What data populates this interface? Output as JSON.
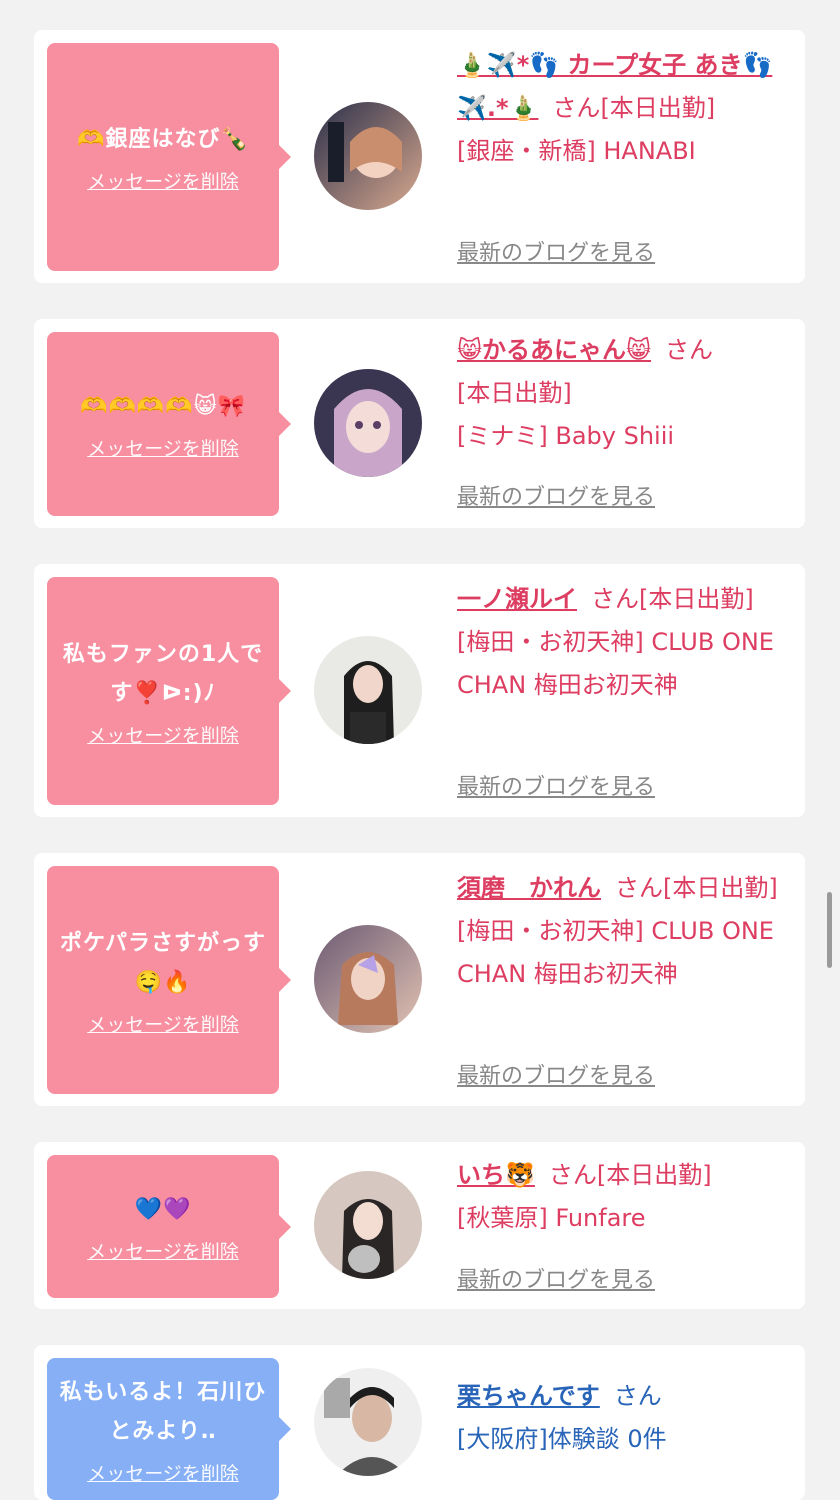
{
  "cards": [
    {
      "message": "🫶銀座はなび🍾",
      "delete_label": "メッセージを削除",
      "name": "🎍✈️*👣 カープ女子 あき👣✈️.*🎍",
      "honorific": "さん",
      "status": "[本日出勤]",
      "shop": "[銀座・新橋] HANABI",
      "blog_label": "最新のブログを見る",
      "bubble_color": "#f78fa0"
    },
    {
      "message": "🫶🫶🫶🫶😸🎀",
      "delete_label": "メッセージを削除",
      "name": "😸かるあにゃん😸",
      "honorific": "さん",
      "status": "[本日出勤]",
      "shop": "[ミナミ] Baby Shiii",
      "blog_label": "最新のブログを見る",
      "bubble_color": "#f78fa0"
    },
    {
      "message": "私もファンの1人です❣️ᐅ:)ﾉ",
      "delete_label": "メッセージを削除",
      "name": "一ノ瀬ルイ",
      "honorific": "さん",
      "status": "[本日出勤]",
      "shop": "[梅田・お初天神] CLUB ONE CHAN 梅田お初天神",
      "blog_label": "最新のブログを見る",
      "bubble_color": "#f78fa0"
    },
    {
      "message": "ポケパラさすがっす🤤🔥",
      "delete_label": "メッセージを削除",
      "name": "須磨　かれん",
      "honorific": "さん",
      "status": "[本日出勤]",
      "shop": "[梅田・お初天神] CLUB ONE CHAN 梅田お初天神",
      "blog_label": "最新のブログを見る",
      "bubble_color": "#f78fa0"
    },
    {
      "message": "💙💜",
      "delete_label": "メッセージを削除",
      "name": "いち🐯",
      "honorific": "さん",
      "status": "[本日出勤]",
      "shop": "[秋葉原] Funfare",
      "blog_label": "最新のブログを見る",
      "bubble_color": "#f78fa0"
    },
    {
      "message": "私もいるよ！石川ひとみより‥",
      "delete_label": "メッセージを削除",
      "name": "栗ちゃんです",
      "honorific": "さん",
      "status": "",
      "shop": "[大阪府]体験談 0件",
      "blog_label": "",
      "bubble_color": "#86aff6"
    }
  ],
  "colors": {
    "page_bg": "#f2f2f2",
    "pink_text": "#dd3d61",
    "blue_text": "#2864b8",
    "link_gray": "#888888"
  }
}
